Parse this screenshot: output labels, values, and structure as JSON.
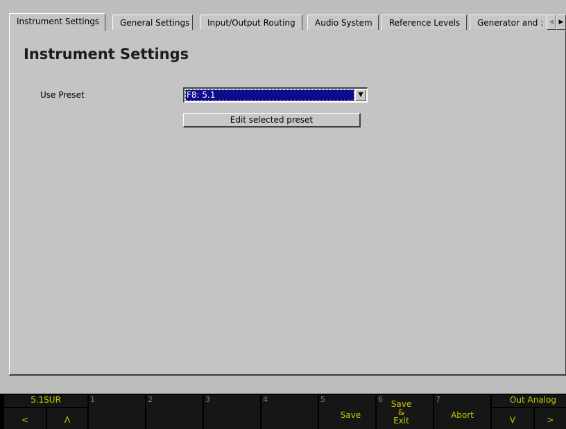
{
  "tabs": [
    {
      "label": "Instrument Settings",
      "active": true
    },
    {
      "label": "General Settings"
    },
    {
      "label": "Input/Output Routing"
    },
    {
      "label": "Audio System"
    },
    {
      "label": "Reference Levels"
    },
    {
      "label": "Generator and :"
    }
  ],
  "tab_arrows": {
    "left": "◀",
    "right": "▶"
  },
  "main": {
    "title": "Instrument Settings",
    "preset_label": "Use Preset",
    "preset_value": "F8: 5.1",
    "dropdown_icon": "▼",
    "edit_button": "Edit selected preset"
  },
  "softkeys": {
    "mode": "5.1SUR",
    "left": "<",
    "up": "Λ",
    "k1_num": "1",
    "k2_num": "2",
    "k3_num": "3",
    "k4_num": "4",
    "k5_num": "5",
    "k5_label": "Save",
    "k6_num": "6",
    "k6_label_1": "Save",
    "k6_label_2": "&",
    "k6_label_3": "Exit",
    "k7_num": "7",
    "k7_label": "Abort",
    "out": "Out Analog",
    "down": "V",
    "right": ">"
  },
  "colors": {
    "background": "#bdbdbd",
    "selection": "#0c0c8c",
    "softkey_text": "#c8c800"
  }
}
